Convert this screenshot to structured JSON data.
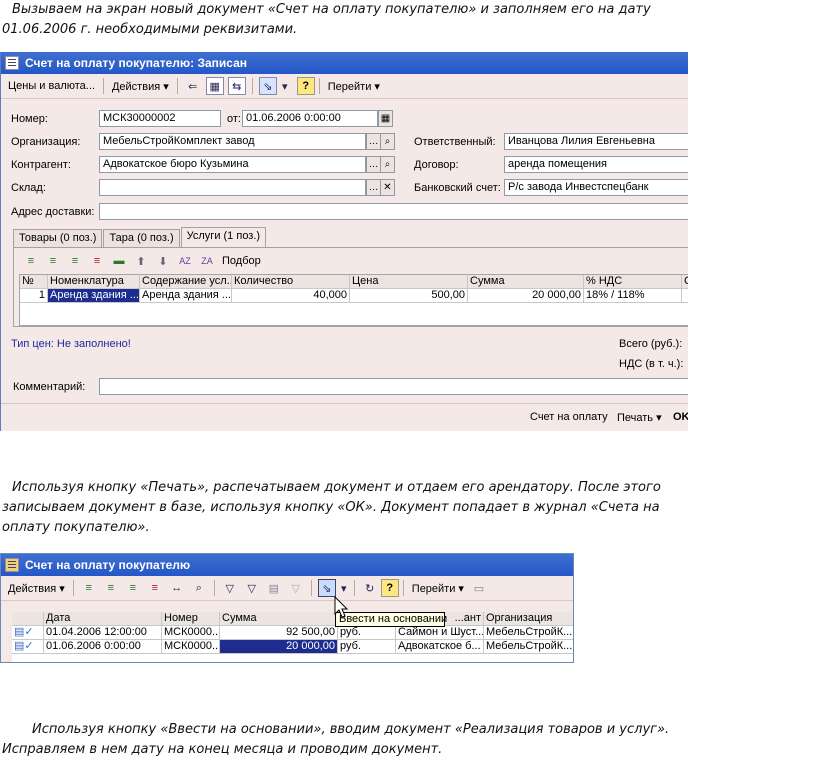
{
  "paragraphs": {
    "p1": [
      "Вызываем на экран новый документ «Счет на оплату покупателю» и заполняем его на дату",
      "01.06.2006 г. необходимыми реквизитами."
    ],
    "p2": [
      "Используя кнопку «Печать», распечатываем документ и отдаем его арендатору. После этого",
      "записываем документ в базе, используя кнопку «ОК». Документ попадает в журнал «Счета на",
      "оплату покупателю»."
    ],
    "p3": [
      "Используя кнопку «Ввести на основании», вводим документ «Реализация товаров и услуг».",
      "Исправляем в нем дату на конец месяца и проводим документ."
    ]
  },
  "doc_window": {
    "title": "Счет на оплату покупателю: Записан",
    "toolbar": {
      "prices": "Цены и валюта...",
      "actions": "Действия ▾",
      "goto": "Перейти ▾",
      "help": "?"
    },
    "labels": {
      "number": "Номер:",
      "from": "от:",
      "org": "Организация:",
      "contractor": "Контрагент:",
      "warehouse": "Склад:",
      "address": "Адрес доставки:",
      "responsible": "Ответственный:",
      "contract": "Договор:",
      "bank": "Банковский счет:"
    },
    "values": {
      "number": "МСК30000002",
      "date": "01.06.2006  0:00:00",
      "org": "МебельСтройКомплект завод",
      "contractor": "Адвокатское бюро Кузьмина",
      "warehouse": "",
      "address": "",
      "responsible": "Иванцова Лилия Евгеньевна",
      "contract": "аренда помещения",
      "bank": "Р/с завода Инвестспецбанк"
    },
    "tabs": [
      "Товары (0 поз.)",
      "Тара (0 поз.)",
      "Услуги (1 поз.)"
    ],
    "podbor": "Подбор",
    "grid_headers": [
      "№",
      "Номенклатура",
      "Содержание усл...",
      "Количество",
      "Цена",
      "Сумма",
      "% НДС",
      "С"
    ],
    "grid_rows": [
      [
        "1",
        "Аренда здания ...",
        "Аренда здания ...",
        "40,000",
        "500,00",
        "20 000,00",
        "18% / 118%",
        ""
      ]
    ],
    "price_type": "Тип цен: Не заполнено!",
    "total_label": "Всего (руб.):",
    "vat_label": "НДС (в т. ч.):",
    "comment_label": "Комментарий:",
    "comment": "",
    "bottom_buttons": {
      "invoice": "Счет на оплату",
      "print": "Печать ▾",
      "ok": "OK"
    }
  },
  "journal_window": {
    "title": "Счет на оплату покупателю",
    "toolbar": {
      "actions": "Действия ▾",
      "goto": "Перейти ▾",
      "help": "?"
    },
    "tooltip": "Ввести на основании",
    "grid_headers": [
      "",
      "Дата",
      "Номер",
      "Сумма",
      "",
      "...ант",
      "Организация"
    ],
    "grid_rows": [
      [
        "",
        "01.04.2006 12:00:00",
        "МСК0000...",
        "92 500,00",
        "руб.",
        "Саймон и Шуст...",
        "МебельСтройК..."
      ],
      [
        "",
        "01.06.2006 0:00:00",
        "МСК0000...",
        "20 000,00",
        "руб.",
        "Адвокатское б...",
        "МебельСтройК..."
      ]
    ]
  }
}
